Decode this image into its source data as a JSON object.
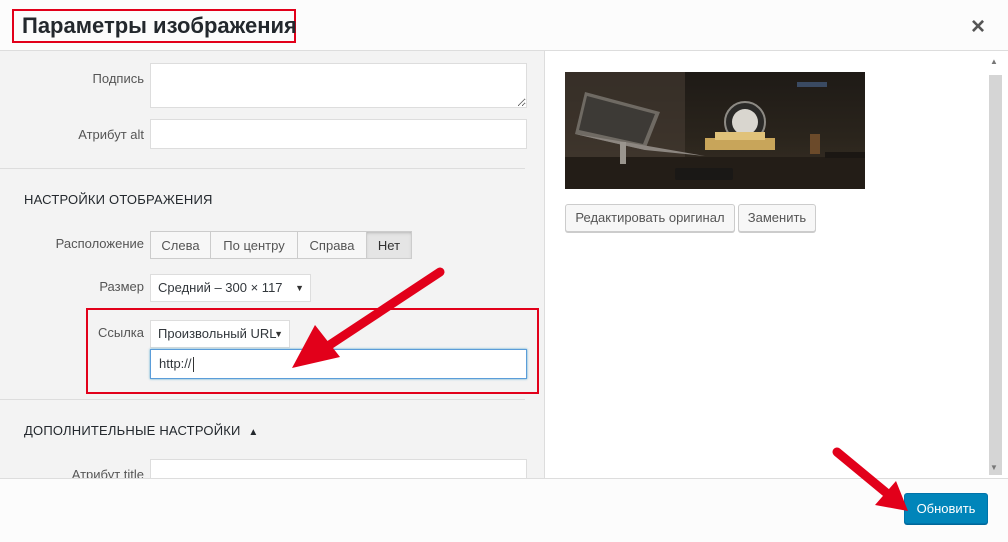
{
  "modal": {
    "title": "Параметры изображения",
    "close_glyph": "×"
  },
  "form": {
    "caption_label": "Подпись",
    "caption_value": "",
    "alt_label": "Атрибут alt",
    "alt_value": ""
  },
  "display": {
    "section_title": "НАСТРОЙКИ ОТОБРАЖЕНИЯ",
    "align_label": "Расположение",
    "align_options": [
      "Слева",
      "По центру",
      "Справа",
      "Нет"
    ],
    "align_selected": "Нет",
    "size_label": "Размер",
    "size_value": "Средний – 300 × 117",
    "link_label": "Ссылка",
    "link_value": "Произвольный URL",
    "url_value": "http://"
  },
  "advanced": {
    "section_title": "ДОПОЛНИТЕЛЬНЫЕ НАСТРОЙКИ",
    "toggle_glyph": "▲",
    "title_attr_label": "Атрибут title"
  },
  "preview": {
    "edit_original": "Редактировать оригинал",
    "replace": "Заменить"
  },
  "footer": {
    "update": "Обновить"
  },
  "glyphs": {
    "dropdown": "▼",
    "scroll_up": "▲",
    "scroll_down": "▼"
  },
  "colors": {
    "accent": "#0085ba",
    "highlight_red": "#e2001a"
  }
}
